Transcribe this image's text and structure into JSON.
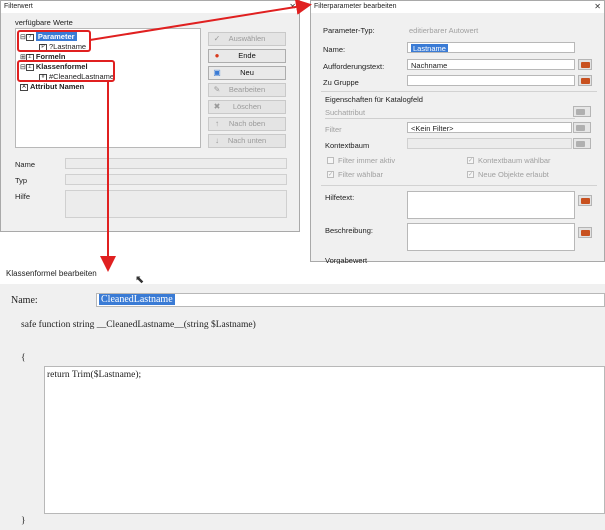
{
  "filterwert": {
    "title": "Filterwert",
    "group_label": "verfügbare Werte",
    "tree": {
      "parameter": "Parameter",
      "lastname": "?Lastname",
      "formeln": "Formeln",
      "klassenformel": "Klassenformel",
      "cleaned": "#CleanedLastname",
      "attribut": "Attribut Namen"
    },
    "buttons": {
      "auswaehlen": "Auswählen",
      "ende": "Ende",
      "neu": "Neu",
      "bearbeiten": "Bearbeiten",
      "loeschen": "Löschen",
      "nach_oben": "Nach oben",
      "nach_unten": "Nach unten"
    },
    "labels": {
      "name": "Name",
      "typ": "Typ",
      "hilfe": "Hilfe"
    }
  },
  "filterparam": {
    "title": "Filterparameter bearbeiten",
    "parameter_typ_label": "Parameter-Typ:",
    "parameter_typ_value": "editierbarer Autowert",
    "name_label": "Name:",
    "name_value": "Lastname",
    "aufforderung_label": "Aufforderungstext:",
    "aufforderung_value": "Nachname",
    "gruppe_label": "Zu Gruppe",
    "gruppe_value": "",
    "eigenschaften_label": "Eigenschaften für Katalogfeld",
    "suchattribut_label": "Suchattribut",
    "filter_label": "Filter",
    "filter_value": "<Kein Filter>",
    "kontextbaum_label": "Kontextbaum",
    "filter_immer_aktiv": "Filter immer aktiv",
    "kontextbaum_waehlbar": "Kontextbaum wählbar",
    "filter_waehlbar": "Filter wählbar",
    "neue_objekte": "Neue Objekte erlaubt",
    "hilfetext_label": "Hilfetext:",
    "beschreibung_label": "Beschreibung:",
    "vorgabewert_label": "Vorgabewert"
  },
  "klassenformel": {
    "title": "Klassenformel bearbeiten",
    "name_label": "Name:",
    "name_value": "CleanedLastname",
    "signature": "safe function string __CleanedLastname__(string $Lastname)",
    "open_brace": "{",
    "body": "return Trim($Lastname);",
    "close_brace": "}"
  },
  "colors": {
    "accent": "#3a7bd5",
    "highlight": "#e02020"
  }
}
